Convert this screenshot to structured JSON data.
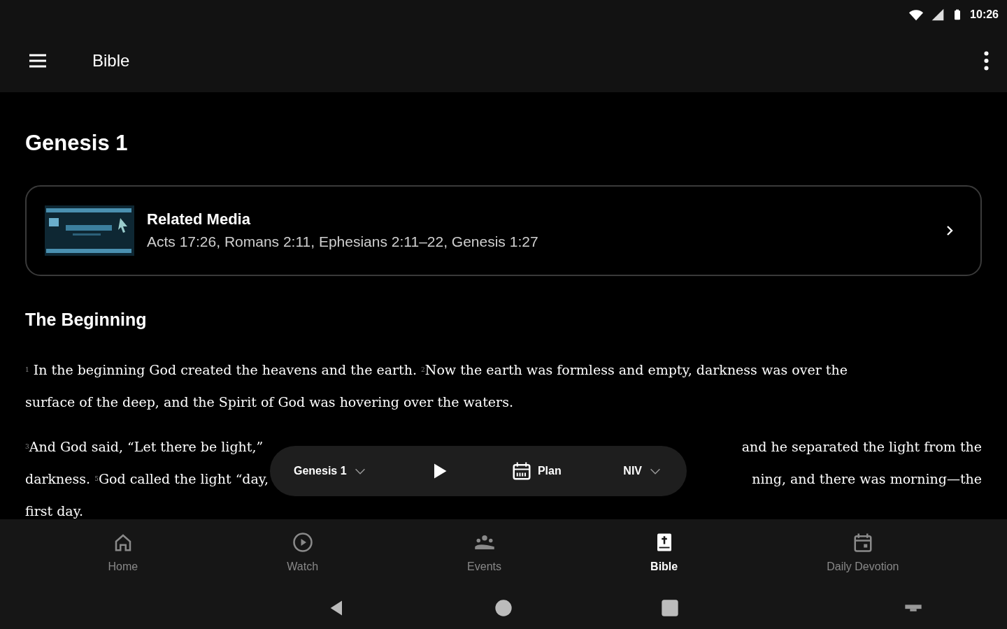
{
  "status_bar": {
    "time": "10:26"
  },
  "app_bar": {
    "title": "Bible"
  },
  "chapter_title": "Genesis 1",
  "related_media": {
    "title": "Related Media",
    "references": "Acts 17:26, Romans 2:11, Ephesians 2:11–22, Genesis 1:27"
  },
  "section_heading": "The Beginning",
  "paragraphs": [
    {
      "lines": [
        {
          "left": "$^{1}$ In the beginning God created the heavens and the earth. $^{2}$Now the earth was formless and empty, darkness was over the"
        },
        {
          "left": "surface of the deep, and the Spirit of God was hovering over the waters."
        }
      ]
    },
    {
      "lines": [
        {
          "left": "$^{3}$And God said, “Let there be light,”",
          "right": "and he separated the light from the"
        },
        {
          "left": "darkness. $^{5}$God called the light “day,",
          "right": "ning, and there was morning—the"
        },
        {
          "left": "first day."
        }
      ]
    }
  ],
  "reader_bar": {
    "book": "Genesis 1",
    "plan": "Plan",
    "version": "NIV"
  },
  "bottom_nav": [
    {
      "label": "Home",
      "selected": false
    },
    {
      "label": "Watch",
      "selected": false
    },
    {
      "label": "Events",
      "selected": false
    },
    {
      "label": "Bible",
      "selected": true
    },
    {
      "label": "Daily Devotion",
      "selected": false
    }
  ]
}
